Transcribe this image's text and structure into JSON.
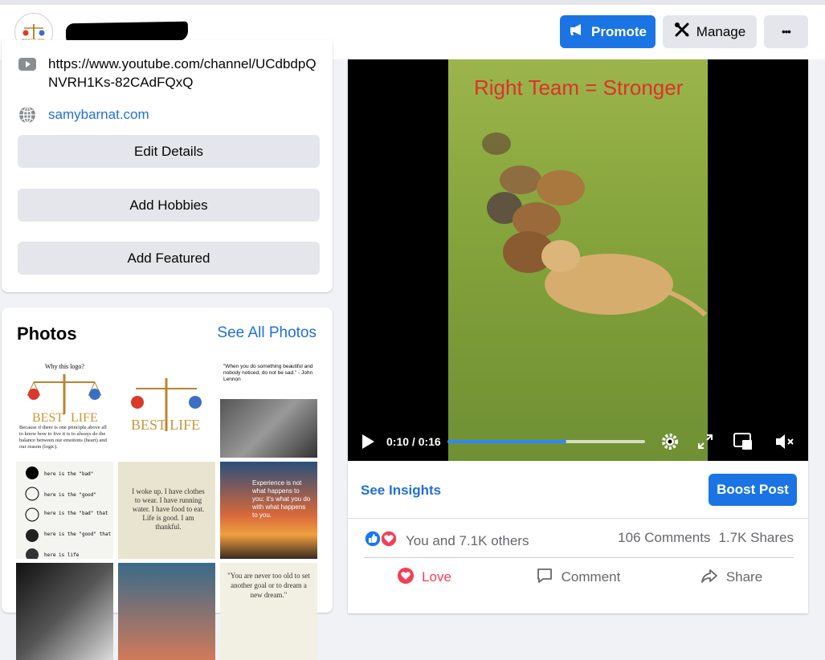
{
  "header": {
    "promote_label": "Promote",
    "manage_label": "Manage",
    "more_label": "•••"
  },
  "intro": {
    "youtube_url": "https://www.youtube.com/channel/UCdbdpQNVRH1Ks-82CAdFQxQ",
    "website": "samybarnat.com",
    "buttons": [
      "Edit Details",
      "Add Hobbies",
      "Add Featured"
    ]
  },
  "photos": {
    "title": "Photos",
    "see_all": "See All Photos",
    "thumbs": [
      {
        "text": "Why this logo?"
      },
      {
        "text": "BEST LIFE"
      },
      {
        "text": "\"When you do something beautiful and nobody noticed, do not be sad.\" - John Lennon"
      },
      {
        "text": "here is the \"bad\""
      },
      {
        "text": "I woke up. I have clothes to wear. I have running water. I have food to eat. Life is good. I am thankful."
      },
      {
        "text": "Experience is not what happens to you; it's what you do with what happens to you."
      },
      {
        "text": ""
      },
      {
        "text": ""
      },
      {
        "text": "\"You are never too old to set another goal or to dream a new dream.\""
      }
    ]
  },
  "video": {
    "overlay_text": "Right Team = Stronger",
    "time": "0:10 / 0:16",
    "progress": 0.6
  },
  "post": {
    "see_insights": "See Insights",
    "boost_label": "Boost Post",
    "reactions_text": "You and 7.1K others",
    "comments_count": "106 Comments",
    "shares_count": "1.7K Shares",
    "love_label": "Love",
    "comment_label": "Comment",
    "share_label": "Share"
  },
  "colors": {
    "accent": "#1b74e4",
    "link": "#216fdb",
    "love": "#f33e58"
  }
}
